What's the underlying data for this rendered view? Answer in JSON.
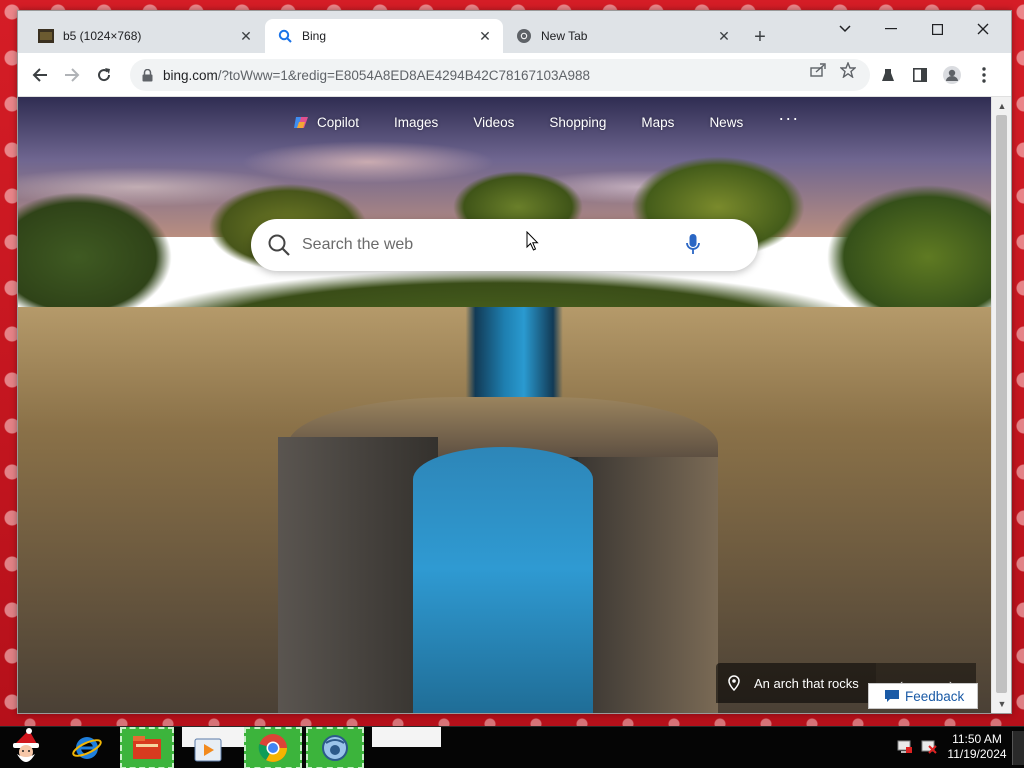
{
  "browser": {
    "tabs": [
      {
        "title": "b5 (1024×768)",
        "icon": "image-thumbnail-icon",
        "active": false
      },
      {
        "title": "Bing",
        "icon": "bing-search-icon",
        "active": true
      },
      {
        "title": "New Tab",
        "icon": "chrome-icon",
        "active": false
      }
    ],
    "new_tab_label": "+",
    "url_host": "bing.com",
    "url_rest": "/?toWww=1&redig=E8054A8ED8AE4294B42C78167103A988",
    "scroll_position": 0
  },
  "bing": {
    "nav": [
      "Copilot",
      "Images",
      "Videos",
      "Shopping",
      "Maps",
      "News"
    ],
    "nav_more": "···",
    "search_placeholder": "Search the web",
    "search_value": "",
    "caption": "An arch that rocks",
    "feedback": "Feedback"
  },
  "taskbar": {
    "apps": [
      "santa-start-icon",
      "internet-explorer-icon",
      "file-folder-icon",
      "media-player-icon",
      "chrome-icon",
      "network-app-icon"
    ],
    "time": "11:50 AM",
    "date": "11/19/2024"
  },
  "colors": {
    "accent_blue": "#1a5aa6",
    "taskbar_highlight": "#3cb43c",
    "wallpaper_red": "#c8141c"
  }
}
